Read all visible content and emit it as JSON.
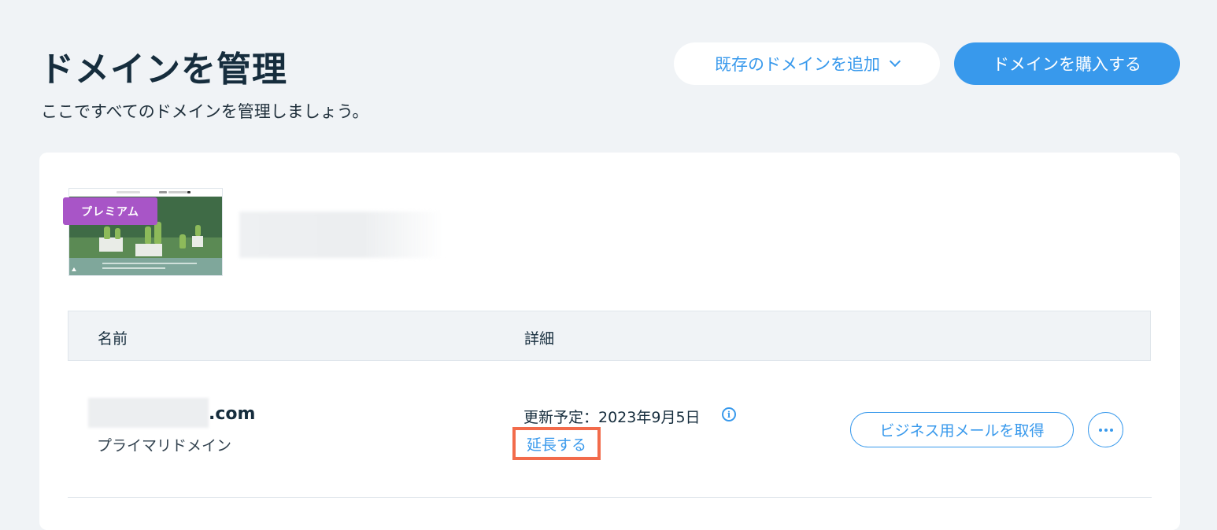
{
  "header": {
    "title": "ドメインを管理",
    "subtitle": "ここですべてのドメインを管理しましょう。",
    "add_existing_label": "既存のドメインを追加",
    "buy_label": "ドメインを購入する"
  },
  "site": {
    "badge": "プレミアム"
  },
  "table": {
    "columns": [
      "名前",
      "詳細"
    ],
    "rows": [
      {
        "domain_suffix": ".com",
        "domain_type": "プライマリドメイン",
        "renewal": "更新予定：2023年9月5日",
        "extend_label": "延長する",
        "email_button": "ビジネス用メールを取得"
      }
    ]
  },
  "colors": {
    "accent": "#3899ec",
    "premium_badge": "#a855c7",
    "highlight": "#f26b4b"
  },
  "icons": [
    "chevron-down-icon",
    "info-icon",
    "more-icon"
  ]
}
